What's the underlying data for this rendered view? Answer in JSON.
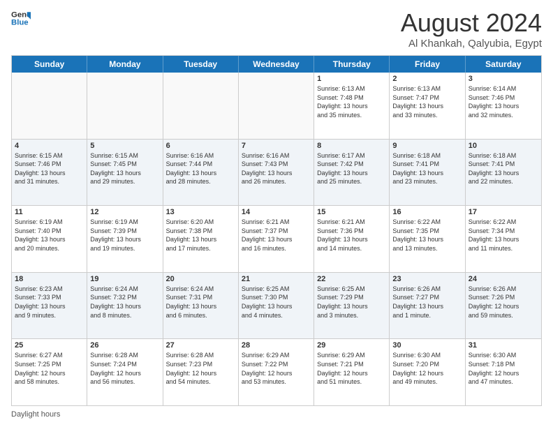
{
  "logo": {
    "line1": "General",
    "line2": "Blue"
  },
  "title": "August 2024",
  "location": "Al Khankah, Qalyubia, Egypt",
  "days_of_week": [
    "Sunday",
    "Monday",
    "Tuesday",
    "Wednesday",
    "Thursday",
    "Friday",
    "Saturday"
  ],
  "footer_label": "Daylight hours",
  "weeks": [
    [
      {
        "day": "",
        "text": ""
      },
      {
        "day": "",
        "text": ""
      },
      {
        "day": "",
        "text": ""
      },
      {
        "day": "",
        "text": ""
      },
      {
        "day": "1",
        "text": "Sunrise: 6:13 AM\nSunset: 7:48 PM\nDaylight: 13 hours\nand 35 minutes."
      },
      {
        "day": "2",
        "text": "Sunrise: 6:13 AM\nSunset: 7:47 PM\nDaylight: 13 hours\nand 33 minutes."
      },
      {
        "day": "3",
        "text": "Sunrise: 6:14 AM\nSunset: 7:46 PM\nDaylight: 13 hours\nand 32 minutes."
      }
    ],
    [
      {
        "day": "4",
        "text": "Sunrise: 6:15 AM\nSunset: 7:46 PM\nDaylight: 13 hours\nand 31 minutes."
      },
      {
        "day": "5",
        "text": "Sunrise: 6:15 AM\nSunset: 7:45 PM\nDaylight: 13 hours\nand 29 minutes."
      },
      {
        "day": "6",
        "text": "Sunrise: 6:16 AM\nSunset: 7:44 PM\nDaylight: 13 hours\nand 28 minutes."
      },
      {
        "day": "7",
        "text": "Sunrise: 6:16 AM\nSunset: 7:43 PM\nDaylight: 13 hours\nand 26 minutes."
      },
      {
        "day": "8",
        "text": "Sunrise: 6:17 AM\nSunset: 7:42 PM\nDaylight: 13 hours\nand 25 minutes."
      },
      {
        "day": "9",
        "text": "Sunrise: 6:18 AM\nSunset: 7:41 PM\nDaylight: 13 hours\nand 23 minutes."
      },
      {
        "day": "10",
        "text": "Sunrise: 6:18 AM\nSunset: 7:41 PM\nDaylight: 13 hours\nand 22 minutes."
      }
    ],
    [
      {
        "day": "11",
        "text": "Sunrise: 6:19 AM\nSunset: 7:40 PM\nDaylight: 13 hours\nand 20 minutes."
      },
      {
        "day": "12",
        "text": "Sunrise: 6:19 AM\nSunset: 7:39 PM\nDaylight: 13 hours\nand 19 minutes."
      },
      {
        "day": "13",
        "text": "Sunrise: 6:20 AM\nSunset: 7:38 PM\nDaylight: 13 hours\nand 17 minutes."
      },
      {
        "day": "14",
        "text": "Sunrise: 6:21 AM\nSunset: 7:37 PM\nDaylight: 13 hours\nand 16 minutes."
      },
      {
        "day": "15",
        "text": "Sunrise: 6:21 AM\nSunset: 7:36 PM\nDaylight: 13 hours\nand 14 minutes."
      },
      {
        "day": "16",
        "text": "Sunrise: 6:22 AM\nSunset: 7:35 PM\nDaylight: 13 hours\nand 13 minutes."
      },
      {
        "day": "17",
        "text": "Sunrise: 6:22 AM\nSunset: 7:34 PM\nDaylight: 13 hours\nand 11 minutes."
      }
    ],
    [
      {
        "day": "18",
        "text": "Sunrise: 6:23 AM\nSunset: 7:33 PM\nDaylight: 13 hours\nand 9 minutes."
      },
      {
        "day": "19",
        "text": "Sunrise: 6:24 AM\nSunset: 7:32 PM\nDaylight: 13 hours\nand 8 minutes."
      },
      {
        "day": "20",
        "text": "Sunrise: 6:24 AM\nSunset: 7:31 PM\nDaylight: 13 hours\nand 6 minutes."
      },
      {
        "day": "21",
        "text": "Sunrise: 6:25 AM\nSunset: 7:30 PM\nDaylight: 13 hours\nand 4 minutes."
      },
      {
        "day": "22",
        "text": "Sunrise: 6:25 AM\nSunset: 7:29 PM\nDaylight: 13 hours\nand 3 minutes."
      },
      {
        "day": "23",
        "text": "Sunrise: 6:26 AM\nSunset: 7:27 PM\nDaylight: 13 hours\nand 1 minute."
      },
      {
        "day": "24",
        "text": "Sunrise: 6:26 AM\nSunset: 7:26 PM\nDaylight: 12 hours\nand 59 minutes."
      }
    ],
    [
      {
        "day": "25",
        "text": "Sunrise: 6:27 AM\nSunset: 7:25 PM\nDaylight: 12 hours\nand 58 minutes."
      },
      {
        "day": "26",
        "text": "Sunrise: 6:28 AM\nSunset: 7:24 PM\nDaylight: 12 hours\nand 56 minutes."
      },
      {
        "day": "27",
        "text": "Sunrise: 6:28 AM\nSunset: 7:23 PM\nDaylight: 12 hours\nand 54 minutes."
      },
      {
        "day": "28",
        "text": "Sunrise: 6:29 AM\nSunset: 7:22 PM\nDaylight: 12 hours\nand 53 minutes."
      },
      {
        "day": "29",
        "text": "Sunrise: 6:29 AM\nSunset: 7:21 PM\nDaylight: 12 hours\nand 51 minutes."
      },
      {
        "day": "30",
        "text": "Sunrise: 6:30 AM\nSunset: 7:20 PM\nDaylight: 12 hours\nand 49 minutes."
      },
      {
        "day": "31",
        "text": "Sunrise: 6:30 AM\nSunset: 7:18 PM\nDaylight: 12 hours\nand 47 minutes."
      }
    ]
  ]
}
